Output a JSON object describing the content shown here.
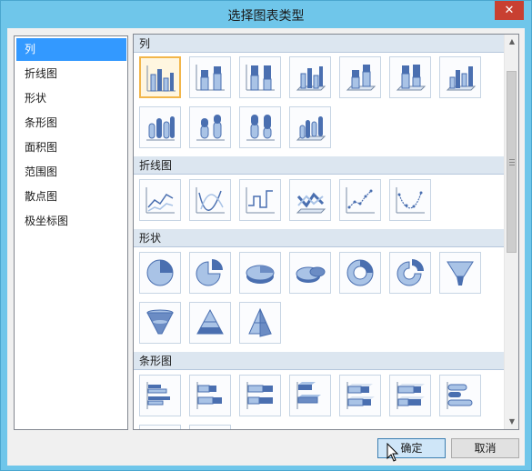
{
  "window": {
    "title": "选择图表类型",
    "close_glyph": "✕"
  },
  "categories": [
    "列",
    "折线图",
    "形状",
    "条形图",
    "面积图",
    "范围图",
    "散点图",
    "极坐标图"
  ],
  "selected_category": 0,
  "sections": [
    {
      "header": "列",
      "icon_count": 11
    },
    {
      "header": "折线图",
      "icon_count": 6
    },
    {
      "header": "形状",
      "icon_count": 10
    },
    {
      "header": "条形图",
      "icon_count": 7
    }
  ],
  "buttons": {
    "ok": "确定",
    "cancel": "取消"
  },
  "colors": {
    "accent": "#3399ff",
    "titlebar": "#6fc6ea",
    "close": "#c84031",
    "icon_blue": "#4a6fb0",
    "icon_light": "#a9c3e6"
  }
}
